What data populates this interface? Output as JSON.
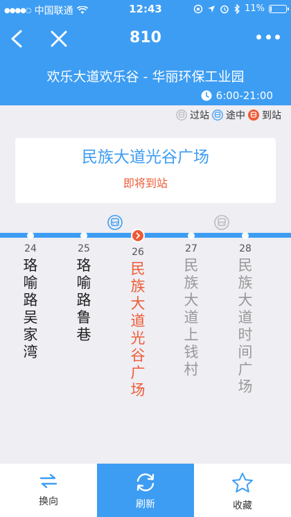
{
  "statusbar": {
    "carrier": "中国联通",
    "time": "12:43",
    "battery": "11%",
    "battery_level": 0.11
  },
  "navbar": {
    "title": "810"
  },
  "route": {
    "name": "欢乐大道欢乐谷 - 华丽环保工业园",
    "hours": "6:00-21:00"
  },
  "legend": {
    "passed": "过站",
    "en_route": "途中",
    "arriving": "到站"
  },
  "card": {
    "station": "民族大道光谷广场",
    "status": "即将到站"
  },
  "stations": [
    {
      "num": "24",
      "name": "珞喻路吴家湾"
    },
    {
      "num": "25",
      "name": "珞喻路鲁巷"
    },
    {
      "num": "26",
      "name": "民族大道光谷广场"
    },
    {
      "num": "27",
      "name": "民族大道上钱村"
    },
    {
      "num": "28",
      "name": "民族大道时间广场"
    }
  ],
  "bottombar": {
    "switch": "换向",
    "refresh": "刷新",
    "favorite": "收藏"
  },
  "colors": {
    "primary": "#3d9df3",
    "accent": "#ef5a36",
    "passed": "#bbbbbb"
  }
}
